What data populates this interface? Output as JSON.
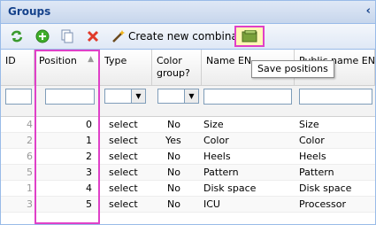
{
  "panel": {
    "title": "Groups"
  },
  "toolbar": {
    "create_label": "Create new combination",
    "tooltip": "Save positions"
  },
  "columns": {
    "id": "ID",
    "position": "Position",
    "type": "Type",
    "color_group": "Color group?",
    "name_en": "Name EN",
    "public_name_en": "Public name EN"
  },
  "rows": [
    {
      "id": "4",
      "position": "0",
      "type": "select",
      "color_group": "No",
      "name": "Size",
      "public_name": "Size"
    },
    {
      "id": "2",
      "position": "1",
      "type": "select",
      "color_group": "Yes",
      "name": "Color",
      "public_name": "Color"
    },
    {
      "id": "6",
      "position": "2",
      "type": "select",
      "color_group": "No",
      "name": "Heels",
      "public_name": "Heels"
    },
    {
      "id": "5",
      "position": "3",
      "type": "select",
      "color_group": "No",
      "name": "Pattern",
      "public_name": "Pattern"
    },
    {
      "id": "1",
      "position": "4",
      "type": "select",
      "color_group": "No",
      "name": "Disk space",
      "public_name": "Disk space"
    },
    {
      "id": "3",
      "position": "5",
      "type": "select",
      "color_group": "No",
      "name": "ICU",
      "public_name": "Processor"
    }
  ]
}
